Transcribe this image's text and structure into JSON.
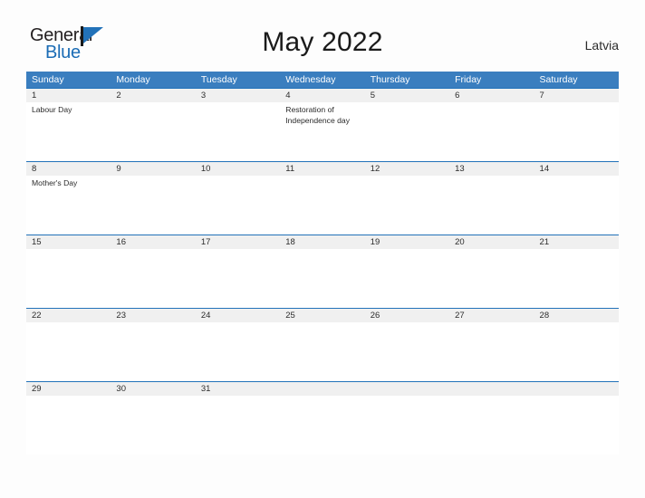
{
  "brand": {
    "name_part1": "General",
    "name_part2": "Blue",
    "logo_icon": "flag-triangle-icon"
  },
  "header": {
    "title": "May 2022",
    "region": "Latvia"
  },
  "colors": {
    "header_blue": "#3a7ebf",
    "row_divider_blue": "#2272b9",
    "daynum_strip_gray": "#f0f0f0",
    "brand_blue": "#1b6cb5",
    "text_dark": "#2b2b2b"
  },
  "calendar": {
    "weekdays": [
      "Sunday",
      "Monday",
      "Tuesday",
      "Wednesday",
      "Thursday",
      "Friday",
      "Saturday"
    ],
    "weeks": [
      [
        {
          "num": "1",
          "events": [
            "Labour Day"
          ]
        },
        {
          "num": "2",
          "events": []
        },
        {
          "num": "3",
          "events": []
        },
        {
          "num": "4",
          "events": [
            "Restoration of Independence day"
          ]
        },
        {
          "num": "5",
          "events": []
        },
        {
          "num": "6",
          "events": []
        },
        {
          "num": "7",
          "events": []
        }
      ],
      [
        {
          "num": "8",
          "events": [
            "Mother's Day"
          ]
        },
        {
          "num": "9",
          "events": []
        },
        {
          "num": "10",
          "events": []
        },
        {
          "num": "11",
          "events": []
        },
        {
          "num": "12",
          "events": []
        },
        {
          "num": "13",
          "events": []
        },
        {
          "num": "14",
          "events": []
        }
      ],
      [
        {
          "num": "15",
          "events": []
        },
        {
          "num": "16",
          "events": []
        },
        {
          "num": "17",
          "events": []
        },
        {
          "num": "18",
          "events": []
        },
        {
          "num": "19",
          "events": []
        },
        {
          "num": "20",
          "events": []
        },
        {
          "num": "21",
          "events": []
        }
      ],
      [
        {
          "num": "22",
          "events": []
        },
        {
          "num": "23",
          "events": []
        },
        {
          "num": "24",
          "events": []
        },
        {
          "num": "25",
          "events": []
        },
        {
          "num": "26",
          "events": []
        },
        {
          "num": "27",
          "events": []
        },
        {
          "num": "28",
          "events": []
        }
      ],
      [
        {
          "num": "29",
          "events": []
        },
        {
          "num": "30",
          "events": []
        },
        {
          "num": "31",
          "events": []
        },
        {
          "num": "",
          "events": []
        },
        {
          "num": "",
          "events": []
        },
        {
          "num": "",
          "events": []
        },
        {
          "num": "",
          "events": []
        }
      ]
    ]
  }
}
